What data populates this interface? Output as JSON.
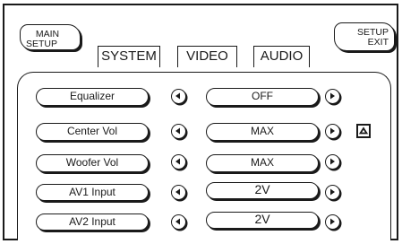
{
  "header": {
    "main_setup": {
      "line1": "MAIN",
      "line2": "SETUP"
    },
    "setup_exit": {
      "line1": "SETUP",
      "line2": "EXIT"
    }
  },
  "tabs": [
    {
      "label": "SYSTEM"
    },
    {
      "label": "VIDEO"
    },
    {
      "label": "AUDIO"
    }
  ],
  "settings": [
    {
      "label": "Equalizer",
      "value": "OFF"
    },
    {
      "label": "Center Vol",
      "value": "MAX"
    },
    {
      "label": "Woofer Vol",
      "value": "MAX"
    },
    {
      "label": "AV1 Input",
      "value": "2V"
    },
    {
      "label": "AV2 Input",
      "value": "2V"
    }
  ],
  "icons": {
    "left": "arrow-left-icon",
    "right": "arrow-right-icon",
    "scroll_up": "triangle-up-icon"
  }
}
